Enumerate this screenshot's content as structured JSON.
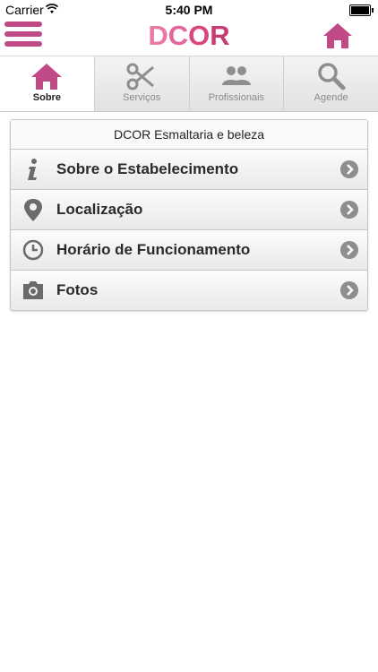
{
  "status_bar": {
    "carrier": "Carrier",
    "time": "5:40 PM"
  },
  "header": {
    "logo": {
      "d": "D",
      "c": "C",
      "o": "O",
      "r": "R"
    },
    "brand_color": "#c04a86"
  },
  "tabs": [
    {
      "label": "Sobre",
      "icon": "home-icon",
      "active": true
    },
    {
      "label": "Serviços",
      "icon": "scissors-icon",
      "active": false
    },
    {
      "label": "Profissionais",
      "icon": "people-icon",
      "active": false
    },
    {
      "label": "Agende",
      "icon": "search-icon",
      "active": false
    }
  ],
  "panel": {
    "title": "DCOR Esmaltaria e beleza",
    "items": [
      {
        "label": "Sobre o Estabelecimento",
        "icon": "info-icon"
      },
      {
        "label": "Localização",
        "icon": "location-pin-icon"
      },
      {
        "label": "Horário de Funcionamento",
        "icon": "clock-icon"
      },
      {
        "label": "Fotos",
        "icon": "camera-icon"
      }
    ]
  }
}
